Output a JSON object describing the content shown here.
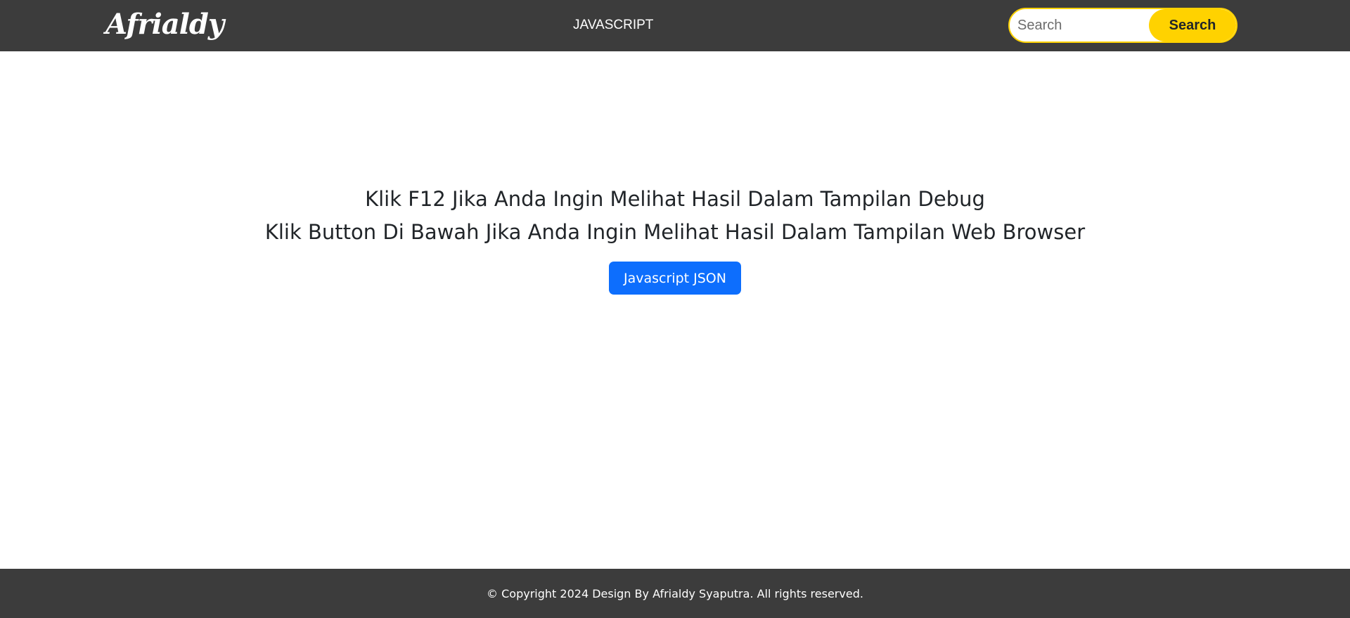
{
  "header": {
    "brand": "Afrialdy",
    "nav_link": "JAVASCRIPT",
    "search": {
      "placeholder": "Search",
      "value": "",
      "button_label": "Search"
    }
  },
  "main": {
    "heading_line1": "Klik F12 Jika Anda Ingin Melihat Hasil Dalam Tampilan Debug",
    "heading_line2": "Klik Button Di Bawah Jika Anda Ingin Melihat Hasil Dalam Tampilan Web Browser",
    "button_label": "Javascript JSON"
  },
  "footer": {
    "copyright": "© Copyright 2024 Design By Afrialdy Syaputra. All rights reserved."
  },
  "colors": {
    "navbar_bg": "#3c3c3c",
    "accent_yellow": "#ffd200",
    "primary_blue": "#0d6efd",
    "text_dark": "#212529"
  }
}
